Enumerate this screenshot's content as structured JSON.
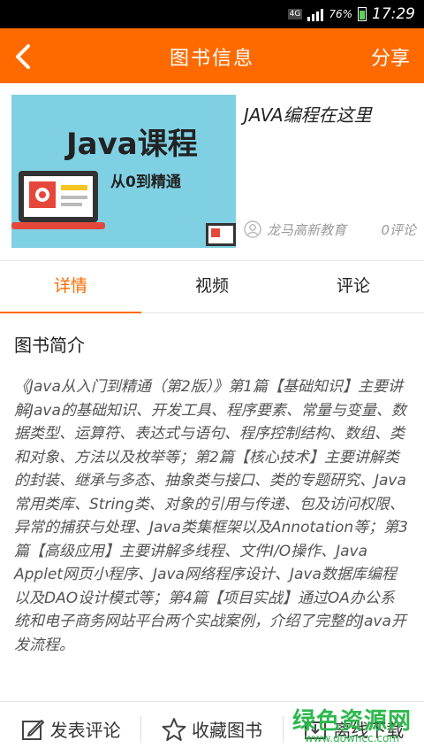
{
  "status_bar": {
    "network": "4G",
    "battery": "76%",
    "time": "17:29",
    "icons": [
      "signal-icon",
      "battery-icon"
    ]
  },
  "app_bar": {
    "title": "图书信息",
    "share_label": "分享",
    "back_icon": "back-arrow-icon",
    "color": "#ff6a00"
  },
  "book": {
    "cover_title": "Java课程",
    "cover_subtitle": "从0到精通",
    "title": "JAVA编程在这里",
    "author": "龙马高新教育",
    "comments": "0评论"
  },
  "tabs": [
    {
      "label": "详情",
      "active": true
    },
    {
      "label": "视频",
      "active": false
    },
    {
      "label": "评论",
      "active": false
    }
  ],
  "section_title": "图书简介",
  "description": "《Java从入门到精通（第2版）》第1篇【基础知识】主要讲解Java的基础知识、开发工具、程序要素、常量与变量、数据类型、运算符、表达式与语句、程序控制结构、数组、类和对象、方法以及枚举等；第2篇【核心技术】主要讲解类的封装、继承与多态、抽象类与接口、类的专题研究、Java常用类库、String类、对象的引用与传递、包及访问权限、异常的捕获与处理、Java类集框架以及Annotation等；第3篇【高级应用】主要讲解多线程、文件I/O操作、Java Applet网页小程序、Java网络程序设计、Java数据库编程以及DAO设计模式等；第4篇【项目实战】通过OA办公系统和电子商务网站平台两个实战案例，介绍了完整的Java开发流程。",
  "bottom_bar": {
    "comment_label": "发表评论",
    "favorite_label": "收藏图书",
    "download_label": "离线下载"
  },
  "watermark": {
    "text": "绿色资源网",
    "url": "www.downcc.com"
  }
}
